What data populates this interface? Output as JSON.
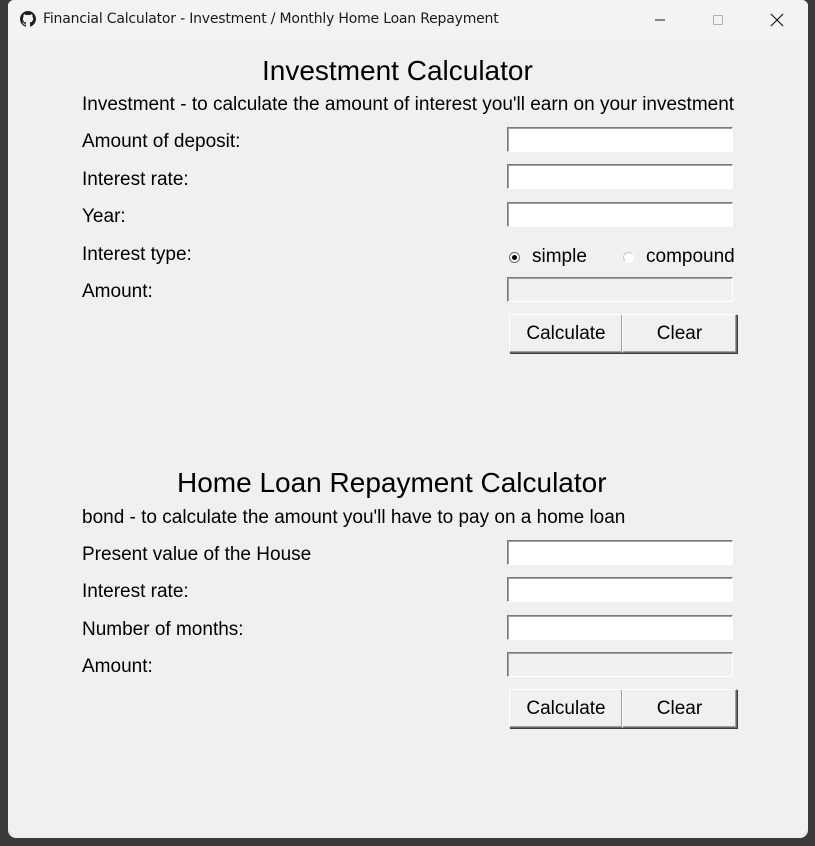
{
  "window": {
    "title": "Financial Calculator - Investment / Monthly Home Loan Repayment"
  },
  "investment": {
    "heading": "Investment Calculator",
    "description": "Investment - to calculate the amount of interest you'll earn on your investment",
    "deposit_label": "Amount of deposit:",
    "deposit_value": "",
    "rate_label": "Interest rate:",
    "rate_value": "",
    "year_label": "Year:",
    "year_value": "",
    "type_label": "Interest type:",
    "type_options": [
      "simple",
      "compound"
    ],
    "type_selected": "simple",
    "amount_label": "Amount:",
    "amount_value": "",
    "calculate_label": "Calculate",
    "clear_label": "Clear"
  },
  "bond": {
    "heading": "Home Loan Repayment Calculator",
    "description": "bond - to calculate the amount you'll have to pay on a home loan",
    "house_label": "Present value of the House",
    "house_value": "",
    "rate_label": "Interest rate:",
    "rate_value": "",
    "months_label": "Number of months:",
    "months_value": "",
    "amount_label": "Amount:",
    "amount_value": "",
    "calculate_label": "Calculate",
    "clear_label": "Clear"
  }
}
